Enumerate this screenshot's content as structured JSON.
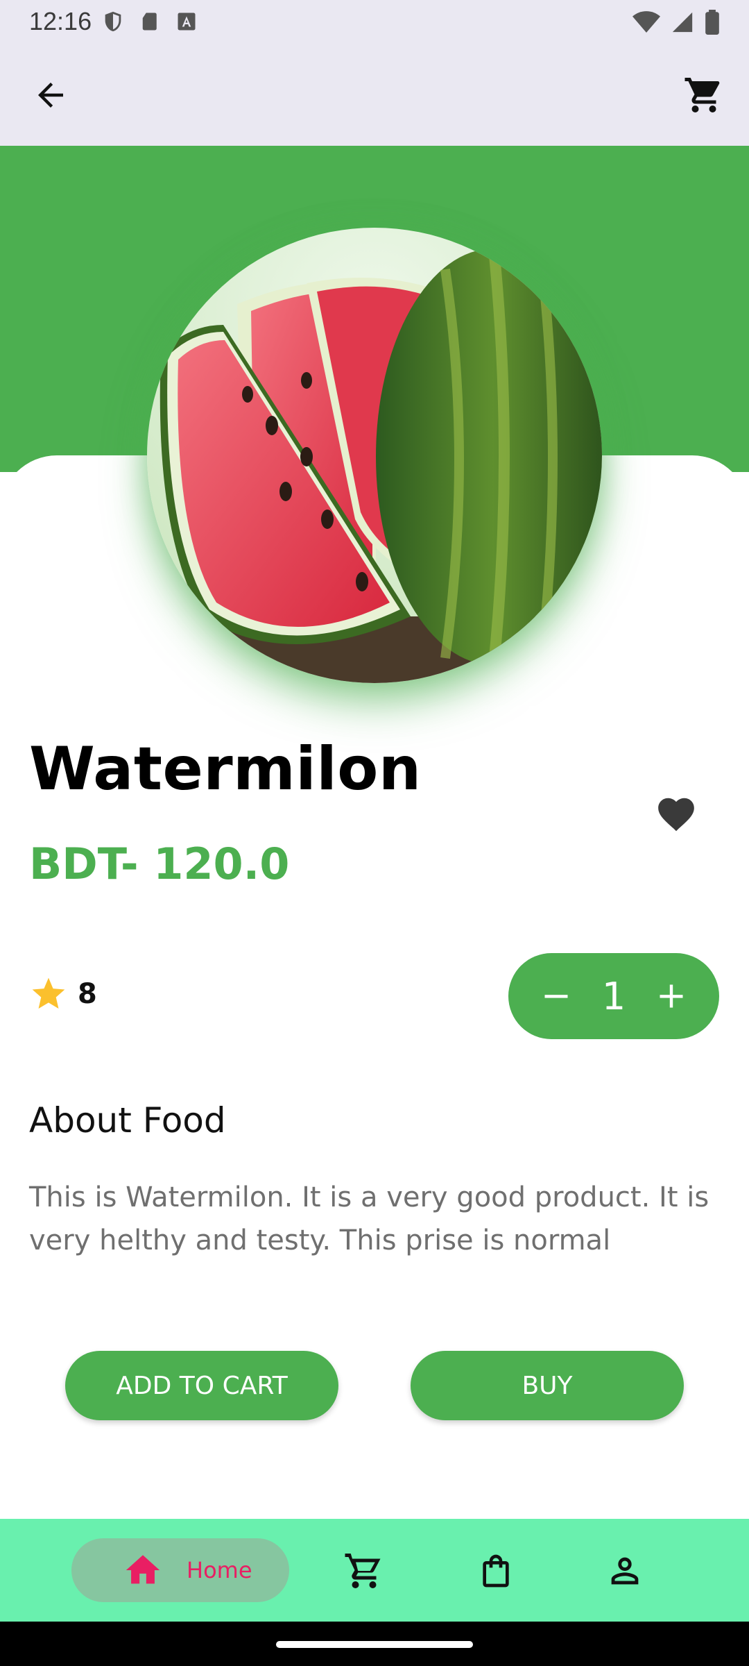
{
  "status_bar": {
    "time": "12:16"
  },
  "product": {
    "name": "Watermilon",
    "price": "BDT- 120.0",
    "rating": "8",
    "quantity": "1",
    "about_heading": "About Food",
    "description": "This is Watermilon. It is a very good product. It is very helthy and testy. This prise is normal"
  },
  "actions": {
    "add_to_cart": "ADD TO CART",
    "buy": "BUY"
  },
  "bottom_nav": {
    "home_label": "Home"
  },
  "colors": {
    "primary_green": "#4caf50",
    "nav_background": "#69f0ae",
    "nav_active_pill": "#86c6a0",
    "nav_active_accent": "#e91e63",
    "rating_star": "#fbc02d",
    "favorite_heart": "#3a3a3a"
  },
  "icons": {
    "back": "arrow-left-icon",
    "cart": "shopping-cart-icon",
    "favorite": "heart-icon",
    "rating": "star-icon",
    "decrease": "minus-icon",
    "increase": "plus-icon",
    "home": "home-icon",
    "nav_cart": "cart-icon",
    "nav_bag": "shopping-bag-icon",
    "nav_profile": "person-icon"
  }
}
